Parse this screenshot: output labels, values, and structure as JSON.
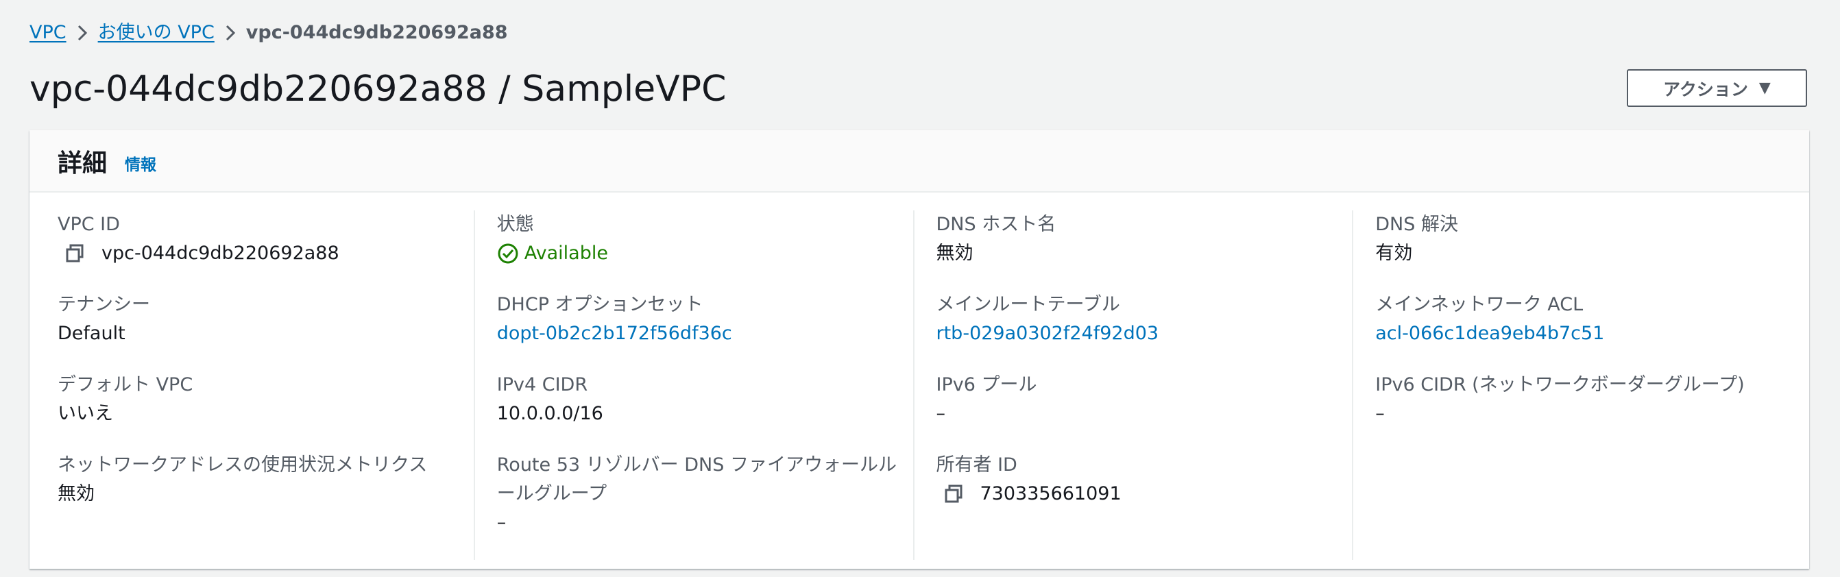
{
  "breadcrumb": {
    "items": [
      "VPC",
      "お使いの VPC"
    ],
    "current": "vpc-044dc9db220692a88"
  },
  "page_title": "vpc-044dc9db220692a88 / SampleVPC",
  "actions_button": "アクション",
  "details": {
    "title": "詳細",
    "info": "情報",
    "columns": [
      [
        {
          "label": "VPC ID",
          "value": "vpc-044dc9db220692a88"
        },
        {
          "label": "テナンシー",
          "value": "Default"
        },
        {
          "label": "デフォルト VPC",
          "value": "いいえ"
        },
        {
          "label": "ネットワークアドレスの使用状況メトリクス",
          "value": "無効"
        }
      ],
      [
        {
          "label": "状態",
          "value": "Available"
        },
        {
          "label": "DHCP オプションセット",
          "value": "dopt-0b2c2b172f56df36c"
        },
        {
          "label": "IPv4 CIDR",
          "value": "10.0.0.0/16"
        },
        {
          "label": "Route 53 リゾルバー DNS ファイアウォールルールグループ",
          "value": "–"
        }
      ],
      [
        {
          "label": "DNS ホスト名",
          "value": "無効"
        },
        {
          "label": "メインルートテーブル",
          "value": "rtb-029a0302f24f92d03"
        },
        {
          "label": "IPv6 プール",
          "value": "–"
        },
        {
          "label": "所有者 ID",
          "value": "730335661091"
        }
      ],
      [
        {
          "label": "DNS 解決",
          "value": "有効"
        },
        {
          "label": "メインネットワーク ACL",
          "value": "acl-066c1dea9eb4b7c51"
        },
        {
          "label": "IPv6 CIDR (ネットワークボーダーグループ)",
          "value": "–"
        }
      ]
    ]
  },
  "colors": {
    "link": "#0073bb",
    "status_available": "#1d8102",
    "label": "#545b64",
    "text": "#16191f"
  },
  "icons": {
    "breadcrumb_separator": "chevron-right-icon",
    "copy": "copy-icon",
    "status": "check-circle-icon",
    "dropdown": "caret-down-icon"
  }
}
